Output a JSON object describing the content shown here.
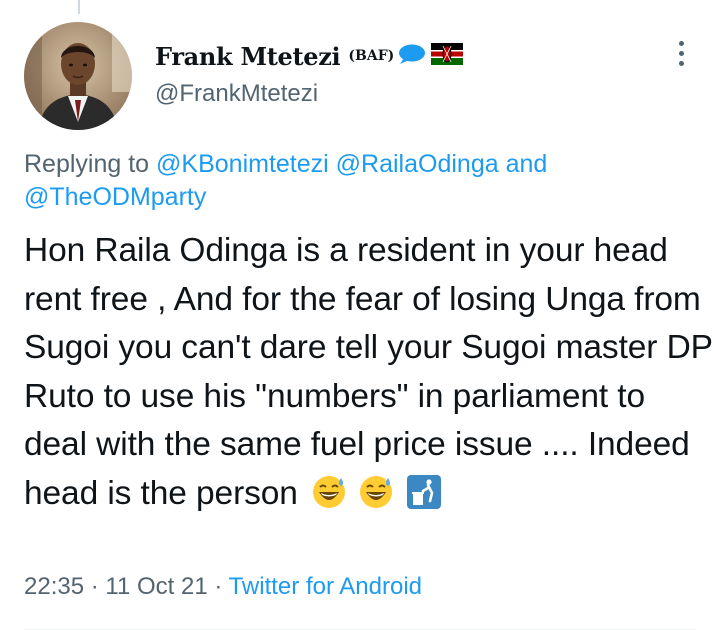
{
  "tweet": {
    "author": {
      "display_name": "Frank Mtetezi",
      "name_badge": "(BAF)",
      "name_emojis": [
        "speech-bubble-icon",
        "kenya-flag-icon"
      ],
      "handle": "@FrankMtetezi"
    },
    "reply_context": {
      "prefix": "Replying to",
      "mentions": [
        "@KBonimtetezi",
        "@RailaOdinga",
        "@TheODMparty"
      ],
      "conjunction": "and"
    },
    "text": "Hon Raila Odinga is a resident in your head rent free , And for the fear of losing Unga from Sugoi you can't dare tell your Sugoi master DP Ruto to use his \"numbers\" in parliament to deal with the same fuel price issue .... Indeed head is the person",
    "text_emojis": [
      "grinning-sweat-icon",
      "grinning-sweat-icon",
      "litter-bin-icon"
    ],
    "meta": {
      "time": "22:35",
      "separator": "·",
      "date": "11 Oct 21",
      "source": "Twitter for Android"
    }
  },
  "colors": {
    "text": "#0f1419",
    "secondary": "#536471",
    "link": "#1d9bf0"
  }
}
